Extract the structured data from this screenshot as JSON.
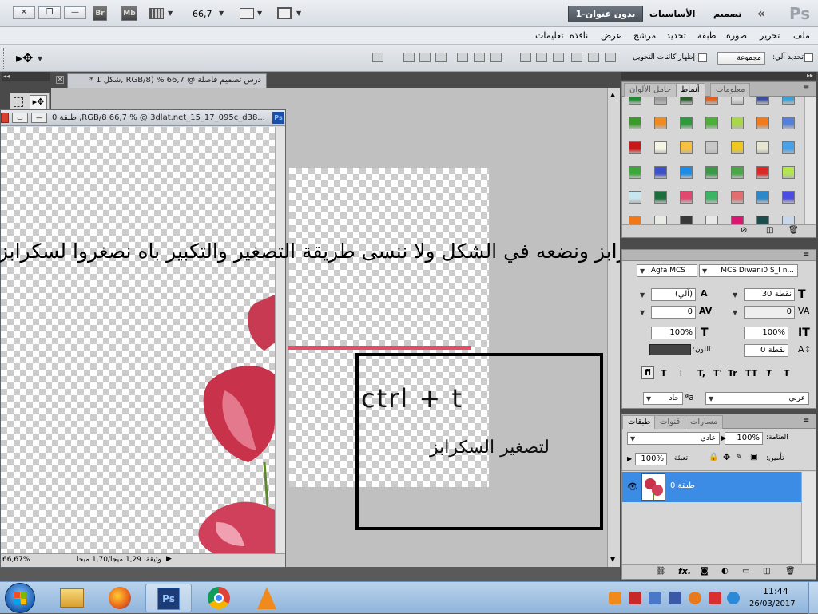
{
  "appbar": {
    "zoom": "66,7",
    "workspace_tab": "بدون عنوان-1",
    "workspace_essentials": "الأساسيات",
    "workspace_design": "تصميم",
    "ps_logo": "Ps",
    "bridge": "Br",
    "minibridge": "Mb"
  },
  "menu": [
    "ملف",
    "تحرير",
    "صورة",
    "طبقة",
    "تحديد",
    "مرشح",
    "عرض",
    "نافذة",
    "تعليمات"
  ],
  "options": {
    "auto_select_label": "تحديد آلي:",
    "auto_select_value": "مجموعة",
    "show_transform_label": "إظهار كائنات التحويل"
  },
  "document": {
    "tab_title": "درس تصميم فاصلة @ 66,7 % (RGB/8 ,شكل 1 *"
  },
  "floating_window": {
    "title": "طبقة 0 ,RGB/8 66,7 % @ 3dlat.net_15_17_095c_d38...",
    "status": "وثيقة: 1,29 ميجا/1,70 ميجا",
    "zoom_status": "66,67%"
  },
  "overlay": {
    "instruction": "نسحب السكرابز ونضعه في الشكل ولا ننسى طريقة التصغير والتكبير باه نصغروا لسكرابز",
    "shortcut": "ctrl + t",
    "caption": "لتصغير السكرابز"
  },
  "swatches_panel": {
    "tabs": [
      "معلومات",
      "أنماط",
      "حامل الألوان"
    ],
    "rows": [
      [
        "#1c8c2c",
        "#9a9a9a",
        "#2a5c2a",
        "#e05f1e",
        "#d9d9d9",
        "#3a4ea0",
        "#3aa0d8"
      ],
      [
        "#3c9a2a",
        "#f08a20",
        "#2e9a3c",
        "#4caf38",
        "#a8d848",
        "#f07a1c",
        "#5580d8"
      ],
      [
        "#c81818",
        "#f5f5e6",
        "#f8c040",
        "#c8c8c8",
        "#f0c81c",
        "#e6e6d2",
        "#48a0e6"
      ],
      [
        "#3ca83c",
        "#3c50c8",
        "#1c8ce6",
        "#3c9848",
        "#48a848",
        "#d82828",
        "#b4e650"
      ],
      [
        "#c8e6f0",
        "#1c6e3c",
        "#e0486e",
        "#3cb464",
        "#e07070",
        "#2e88c8",
        "#4c4ce0"
      ],
      [
        "#f07818",
        "#e8ece4",
        "#383838",
        "#e8e8e8",
        "#d81870",
        "#1c4c4c",
        "#c8d8e8"
      ]
    ]
  },
  "character_panel": {
    "font_family": "MCS Diwani0 S_I n...",
    "font_family_latin": "Agfa MCS",
    "size": "30 نقطة",
    "leading": "(آلي)",
    "tracking": "0",
    "kerning": "0",
    "vscale": "100%",
    "hscale": "100%",
    "baseline": "0 نقطة",
    "color_label": "اللون:",
    "styles": [
      "T",
      "T",
      "TT",
      "Tr",
      "T'",
      "T,",
      "T",
      "T",
      "fi"
    ],
    "language": "عربي",
    "anti_alias": "حاد"
  },
  "layers_panel": {
    "tabs": [
      "طبقات",
      "قنوات",
      "مسارات"
    ],
    "opacity_label": "العتامة:",
    "opacity": "100%",
    "blend": "عادي",
    "lock_label": "تأمين:",
    "fill_label": "تعبئة:",
    "fill": "100%",
    "layer_name": "طبقة 0"
  },
  "taskbar": {
    "time": "11:44",
    "date": "26/03/2017"
  },
  "colors": {
    "selected_layer": "#3c8ce6",
    "pink_line": "#e05068"
  }
}
